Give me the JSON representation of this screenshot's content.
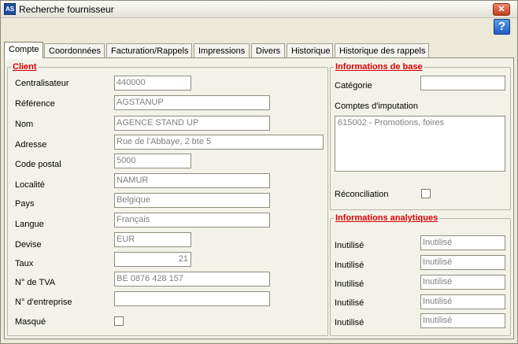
{
  "window": {
    "title": "Recherche fournisseur",
    "app_icon_text": "AS"
  },
  "titlebar": {
    "close_glyph": "✕"
  },
  "toolbar": {
    "help_glyph": "?"
  },
  "tabs": [
    {
      "label": "Compte",
      "active": true
    },
    {
      "label": "Coordonnées"
    },
    {
      "label": "Facturation/Rappels"
    },
    {
      "label": "Impressions"
    },
    {
      "label": "Divers"
    },
    {
      "label": "Historique"
    },
    {
      "label": "Historique des rappels"
    }
  ],
  "client": {
    "title": "Client",
    "fields": [
      {
        "label": "Centralisateur",
        "value": "440000"
      },
      {
        "label": "Référence",
        "value": "AGSTANUP"
      },
      {
        "label": "Nom",
        "value": "AGENCE STAND UP"
      },
      {
        "label": "Adresse",
        "value": "Rue de l'Abbaye, 2 bte 5"
      },
      {
        "label": "Code postal",
        "value": "5000"
      },
      {
        "label": "Localité",
        "value": "NAMUR"
      },
      {
        "label": "Pays",
        "value": "Belgique"
      },
      {
        "label": "Langue",
        "value": "Français"
      },
      {
        "label": "Devise",
        "value": "EUR"
      },
      {
        "label": "Taux",
        "value": "21"
      },
      {
        "label": "N° de TVA",
        "value": "BE 0876 428 157"
      },
      {
        "label": "N° d'entreprise",
        "value": ""
      },
      {
        "label": "Masqué",
        "checked": false
      }
    ]
  },
  "base": {
    "title": "Informations de base",
    "categorie_label": "Catégorie",
    "categorie_value": "",
    "comptes_label": "Comptes d'imputation",
    "comptes_value": "615002 - Promotions, foires",
    "reconciliation_label": "Réconciliation",
    "reconciliation_checked": false
  },
  "analytics": {
    "title": "Informations analytiques",
    "rows": [
      {
        "label": "Inutilisé",
        "placeholder": "Inutilisé"
      },
      {
        "label": "Inutilisé",
        "placeholder": "Inutilisé"
      },
      {
        "label": "Inutilisé",
        "placeholder": "Inutilisé"
      },
      {
        "label": "Inutilisé",
        "placeholder": "Inutilisé"
      },
      {
        "label": "Inutilisé",
        "placeholder": "Inutilisé"
      }
    ]
  }
}
